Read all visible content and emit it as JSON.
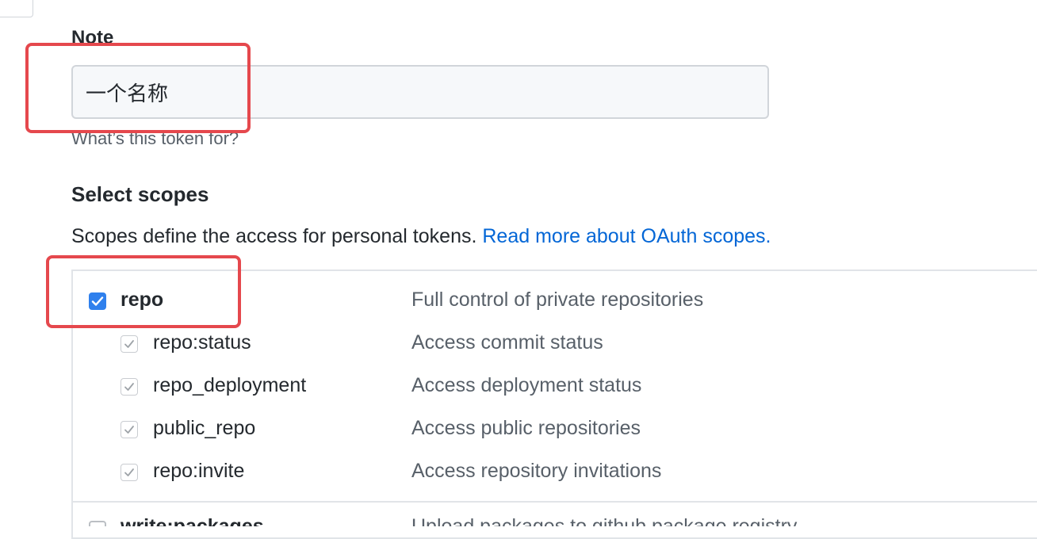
{
  "note": {
    "label": "Note",
    "value": "一个名称",
    "hint": "What’s this token for?"
  },
  "scopes": {
    "title": "Select scopes",
    "description": "Scopes define the access for personal tokens.",
    "link": "Read more about OAuth scopes.",
    "items": [
      {
        "name": "repo",
        "desc": "Full control of private repositories",
        "checked": true
      },
      {
        "name": "repo:status",
        "desc": "Access commit status",
        "checked": true
      },
      {
        "name": "repo_deployment",
        "desc": "Access deployment status",
        "checked": true
      },
      {
        "name": "public_repo",
        "desc": "Access public repositories",
        "checked": true
      },
      {
        "name": "repo:invite",
        "desc": "Access repository invitations",
        "checked": true
      },
      {
        "name": "write:packages",
        "desc": "Upload packages to github package registry",
        "checked": false
      }
    ]
  },
  "colors": {
    "accent": "#2f80ed",
    "link": "#0366d6",
    "annotation": "#e5484d"
  }
}
